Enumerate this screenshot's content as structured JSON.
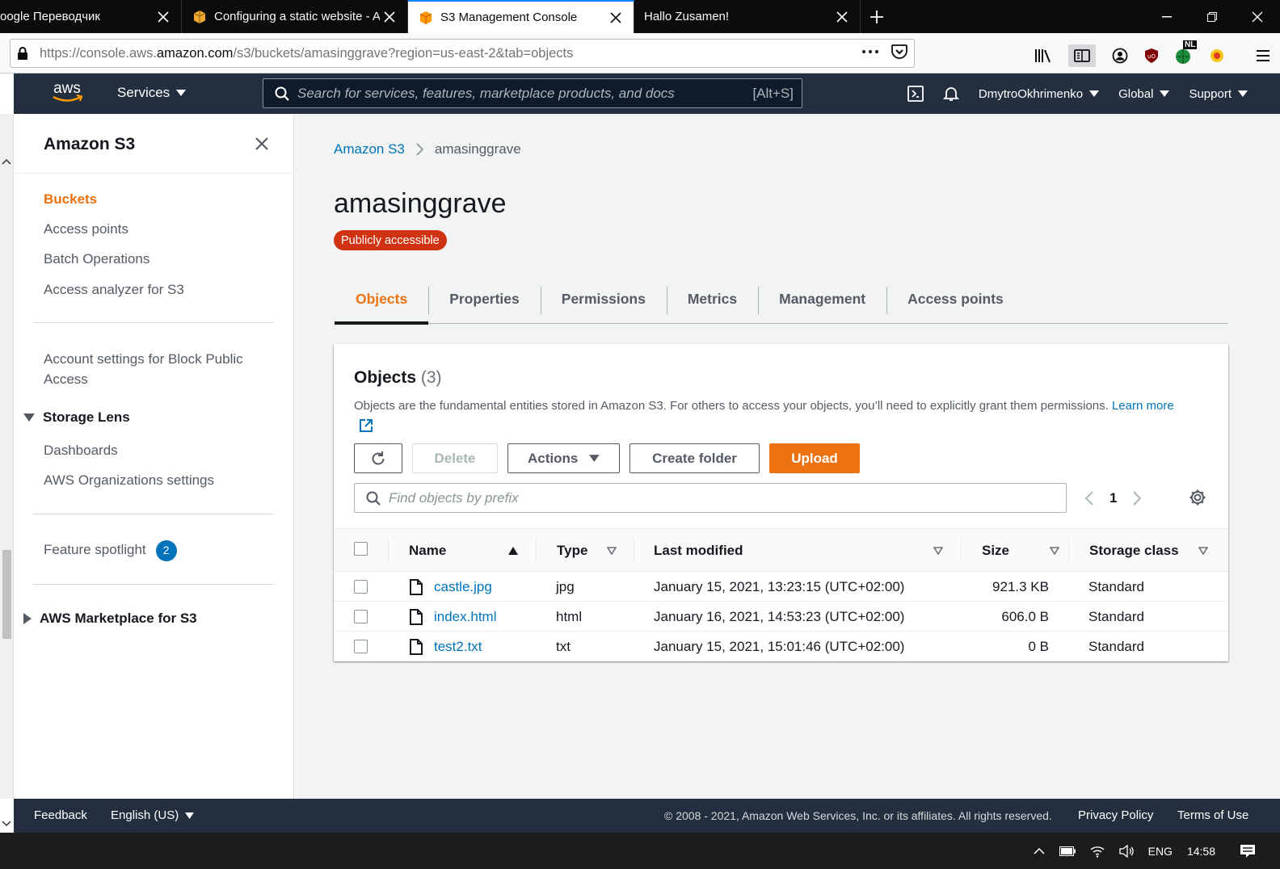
{
  "browser": {
    "tabs": [
      {
        "title": "oogle Переводчик",
        "active": false
      },
      {
        "title": "Configuring a static website - A",
        "active": false
      },
      {
        "title": "S3 Management Console",
        "active": true
      },
      {
        "title": "Hallo Zusamen!",
        "active": false
      }
    ],
    "url_prefix": "https://console.aws.",
    "url_domain": "amazon.com",
    "url_suffix": "/s3/buckets/amasinggrave?region=us-east-2&tab=objects",
    "ext_badge": "NL"
  },
  "aws_header": {
    "logo": "aws",
    "services_label": "Services",
    "search_placeholder": "Search for services, features, marketplace products, and docs",
    "search_shortcut": "[Alt+S]",
    "user": "DmytroOkhrimenko",
    "region": "Global",
    "support": "Support"
  },
  "sidebar": {
    "title": "Amazon S3",
    "items": [
      {
        "label": "Buckets",
        "active": true
      },
      {
        "label": "Access points"
      },
      {
        "label": "Batch Operations"
      },
      {
        "label": "Access analyzer for S3"
      }
    ],
    "account_settings": "Account settings for Block Public Access",
    "storage_lens": {
      "label": "Storage Lens",
      "items": [
        "Dashboards",
        "AWS Organizations settings"
      ]
    },
    "feature_spotlight": {
      "label": "Feature spotlight",
      "count": "2"
    },
    "marketplace": "AWS Marketplace for S3"
  },
  "breadcrumb": {
    "root": "Amazon S3",
    "current": "amasinggrave"
  },
  "bucket": {
    "name": "amasinggrave",
    "badge": "Publicly accessible"
  },
  "tabs": [
    "Objects",
    "Properties",
    "Permissions",
    "Metrics",
    "Management",
    "Access points"
  ],
  "objects_panel": {
    "title": "Objects",
    "count": "(3)",
    "description": "Objects are the fundamental entities stored in Amazon S3. For others to access your objects, you’ll need to explicitly grant them permissions.",
    "learn_more": "Learn more",
    "buttons": {
      "delete": "Delete",
      "actions": "Actions",
      "create_folder": "Create folder",
      "upload": "Upload"
    },
    "filter_placeholder": "Find objects by prefix",
    "page": "1",
    "columns": [
      "Name",
      "Type",
      "Last modified",
      "Size",
      "Storage class"
    ],
    "rows": [
      {
        "name": "castle.jpg",
        "type": "jpg",
        "modified": "January 15, 2021, 13:23:15 (UTC+02:00)",
        "size": "921.3 KB",
        "class": "Standard"
      },
      {
        "name": "index.html",
        "type": "html",
        "modified": "January 16, 2021, 14:53:23 (UTC+02:00)",
        "size": "606.0 B",
        "class": "Standard"
      },
      {
        "name": "test2.txt",
        "type": "txt",
        "modified": "January 15, 2021, 15:01:46 (UTC+02:00)",
        "size": "0 B",
        "class": "Standard"
      }
    ]
  },
  "footer": {
    "feedback": "Feedback",
    "language": "English (US)",
    "copyright": "© 2008 - 2021, Amazon Web Services, Inc. or its affiliates. All rights reserved.",
    "privacy": "Privacy Policy",
    "terms": "Terms of Use"
  },
  "taskbar": {
    "lang": "ENG",
    "time": "14:58"
  },
  "colors": {
    "aws_nav": "#232f3e",
    "accent_orange": "#ec7211",
    "link_blue": "#0073bb",
    "danger_red": "#d13212"
  }
}
